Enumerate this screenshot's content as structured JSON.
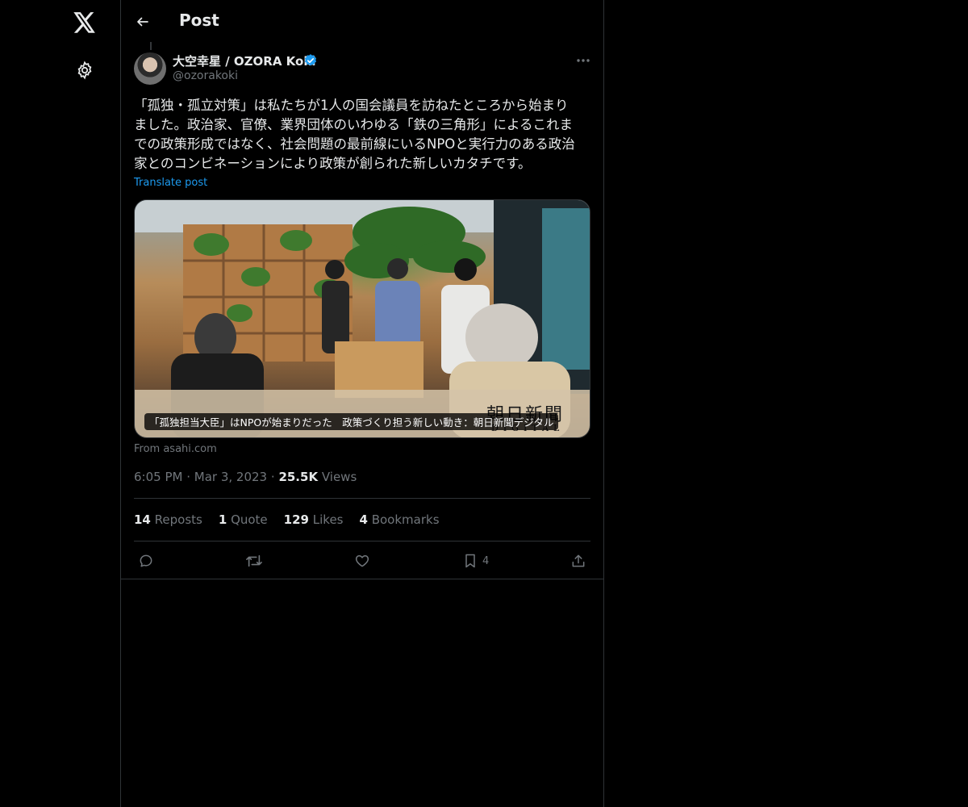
{
  "nav": {
    "logo_icon": "x-logo-icon",
    "settings_icon": "gear-icon"
  },
  "header": {
    "title": "Post",
    "back_icon": "arrow-left-icon"
  },
  "post": {
    "author": {
      "display_name": "大空幸星 / OZORA Koki",
      "handle": "@ozorakoki",
      "verified": true
    },
    "text": "「孤独・孤立対策」は私たちが1人の国会議員を訪ねたところから始まり\nました。政治家、官僚、業界団体のいわゆる「鉄の三角形」によるこれま\nでの政策形成ではなく、社会問題の最前線にいるNPOと実行力のある政治\n家とのコンビネーションにより政策が創られた新しいカタチです。",
    "translate_label": "Translate post",
    "card": {
      "caption": "「孤独担当大臣」はNPOが始まりだった　政策づくり担う新しい動き：朝日新聞デジタル",
      "watermark": "朝日新聞",
      "watermark_sub": "DIGITAL"
    },
    "from_label": "From asahi.com",
    "time": "6:05 PM",
    "date": "Mar 3, 2023",
    "views_count": "25.5K",
    "views_label": "Views",
    "stats": {
      "reposts_count": "14",
      "reposts_label": "Reposts",
      "quote_count": "1",
      "quote_label": "Quote",
      "likes_count": "129",
      "likes_label": "Likes",
      "bookmarks_count": "4",
      "bookmarks_label": "Bookmarks"
    },
    "actions": {
      "bookmark_count": "4"
    }
  },
  "colors": {
    "background": "#000000",
    "text": "#e7e9ea",
    "muted": "#71767b",
    "accent": "#1d9bf0",
    "border": "#2f3336"
  }
}
